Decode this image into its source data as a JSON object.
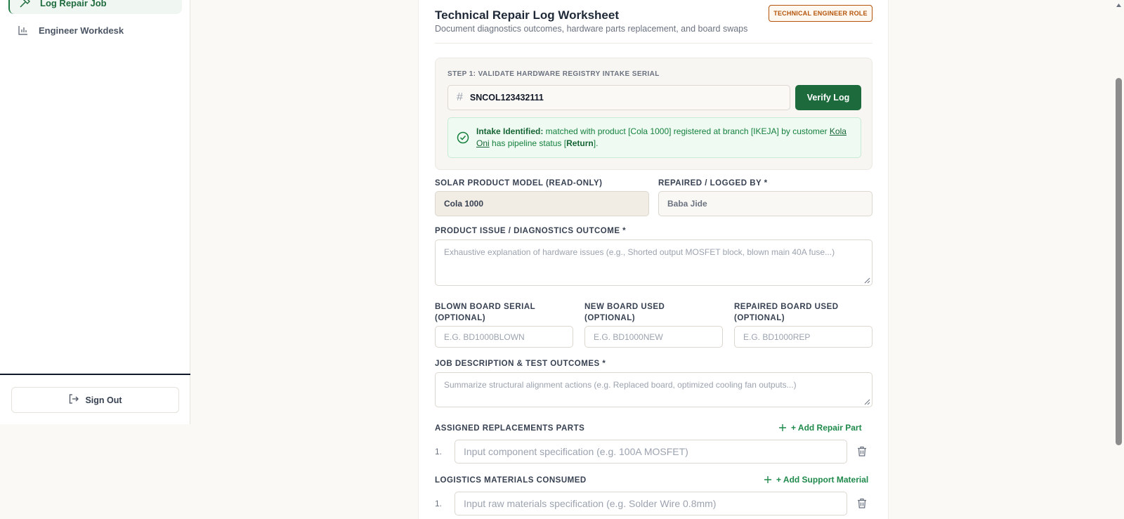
{
  "sidebar": {
    "items": [
      {
        "label": "Log Repair Job",
        "icon": "hammer-icon",
        "active": true
      },
      {
        "label": "Engineer Workdesk",
        "icon": "bar-chart-icon",
        "active": false
      }
    ],
    "sign_out": "Sign Out"
  },
  "header": {
    "title": "Technical Repair Log Worksheet",
    "subtitle": "Document diagnostics outcomes, hardware parts replacement, and board swaps",
    "role_badge": "TECHNICAL ENGINEER ROLE"
  },
  "step1": {
    "label": "STEP 1: VALIDATE HARDWARE REGISTRY INTAKE SERIAL",
    "serial_value": "SNCOL123432111",
    "verify_label": "Verify Log",
    "success": {
      "prefix": "Intake Identified:",
      "part1": " matched with product [Cola 1000] registered at branch [IKEJA] by customer ",
      "customer": "Kola Oni",
      "part2": " has pipeline status [",
      "status": "Return",
      "part3": "]."
    }
  },
  "form": {
    "model_label": "SOLAR PRODUCT MODEL (READ-ONLY)",
    "model_value": "Cola 1000",
    "logged_by_label": "REPAIRED / LOGGED BY *",
    "logged_by_value": "Baba Jide",
    "issue_label": "PRODUCT ISSUE / DIAGNOSTICS OUTCOME *",
    "issue_placeholder": "Exhaustive explanation of hardware issues (e.g., Shorted output MOSFET block, blown main 40A fuse...)",
    "blown_label": "BLOWN BOARD SERIAL (OPTIONAL)",
    "blown_placeholder": "E.G. BD1000BLOWN",
    "new_label": "NEW BOARD USED (OPTIONAL)",
    "new_placeholder": "E.G. BD1000NEW",
    "repaired_label": "REPAIRED BOARD USED (OPTIONAL)",
    "repaired_placeholder": "E.G. BD1000REP",
    "job_label": "JOB DESCRIPTION & TEST OUTCOMES *",
    "job_placeholder": "Summarize structural alignment actions (e.g. Replaced board, optimized cooling fan outputs...)"
  },
  "parts": {
    "label": "ASSIGNED REPLACEMENTS PARTS",
    "add_label": "+ Add Repair Part",
    "rows": [
      {
        "num": "1.",
        "placeholder": "Input component specification (e.g. 100A MOSFET)"
      }
    ]
  },
  "materials": {
    "label": "LOGISTICS MATERIALS CONSUMED",
    "add_label": "+ Add Support Material",
    "rows": [
      {
        "num": "1.",
        "placeholder": "Input raw materials specification (e.g. Solder Wire 0.8mm)"
      }
    ]
  },
  "colors": {
    "accent": "#1d6b3c",
    "success_bg": "#eefaf2",
    "badge": "#b45309"
  }
}
